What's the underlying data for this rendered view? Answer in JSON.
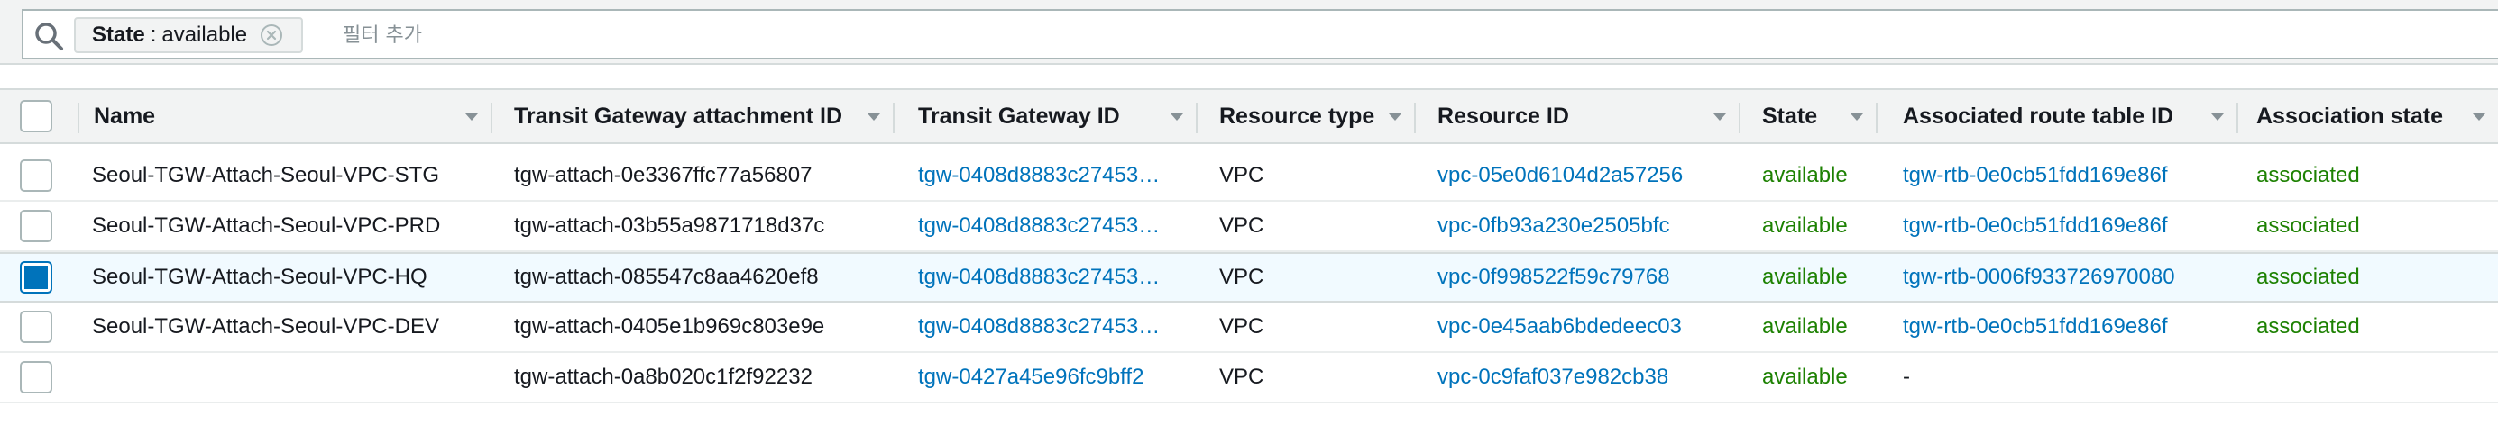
{
  "filter": {
    "token_key": "State",
    "token_sep": ":",
    "token_value": "available",
    "placeholder": "필터 추가"
  },
  "icons": {
    "search": "search-icon",
    "remove_token": "close-circle-icon",
    "sort": "caret-down-icon"
  },
  "colors": {
    "link": "#0073bb",
    "available": "#1d8102",
    "selected_row": "#f1faff",
    "header_bg": "#f2f3f3"
  },
  "table": {
    "columns": [
      "Name",
      "Transit Gateway attachment ID",
      "Transit Gateway ID",
      "Resource type",
      "Resource ID",
      "State",
      "Associated route table ID",
      "Association state"
    ],
    "rows": [
      {
        "selected": false,
        "name": "Seoul-TGW-Attach-Seoul-VPC-STG",
        "attachment_id": "tgw-attach-0e3367ffc77a56807",
        "tgw_id": "tgw-0408d8883c27453…",
        "resource_type": "VPC",
        "resource_id": "vpc-05e0d6104d2a57256",
        "state": "available",
        "route_table_id": "tgw-rtb-0e0cb51fdd169e86f",
        "association_state": "associated"
      },
      {
        "selected": false,
        "name": "Seoul-TGW-Attach-Seoul-VPC-PRD",
        "attachment_id": "tgw-attach-03b55a9871718d37c",
        "tgw_id": "tgw-0408d8883c27453…",
        "resource_type": "VPC",
        "resource_id": "vpc-0fb93a230e2505bfc",
        "state": "available",
        "route_table_id": "tgw-rtb-0e0cb51fdd169e86f",
        "association_state": "associated"
      },
      {
        "selected": true,
        "name": "Seoul-TGW-Attach-Seoul-VPC-HQ",
        "attachment_id": "tgw-attach-085547c8aa4620ef8",
        "tgw_id": "tgw-0408d8883c27453…",
        "resource_type": "VPC",
        "resource_id": "vpc-0f998522f59c79768",
        "state": "available",
        "route_table_id": "tgw-rtb-0006f933726970080",
        "association_state": "associated"
      },
      {
        "selected": false,
        "name": "Seoul-TGW-Attach-Seoul-VPC-DEV",
        "attachment_id": "tgw-attach-0405e1b969c803e9e",
        "tgw_id": "tgw-0408d8883c27453…",
        "resource_type": "VPC",
        "resource_id": "vpc-0e45aab6bdedeec03",
        "state": "available",
        "route_table_id": "tgw-rtb-0e0cb51fdd169e86f",
        "association_state": "associated"
      },
      {
        "selected": false,
        "name": "",
        "attachment_id": "tgw-attach-0a8b020c1f2f92232",
        "tgw_id": "tgw-0427a45e96fc9bff2",
        "resource_type": "VPC",
        "resource_id": "vpc-0c9faf037e982cb38",
        "state": "available",
        "route_table_id": "-",
        "association_state": ""
      }
    ]
  }
}
